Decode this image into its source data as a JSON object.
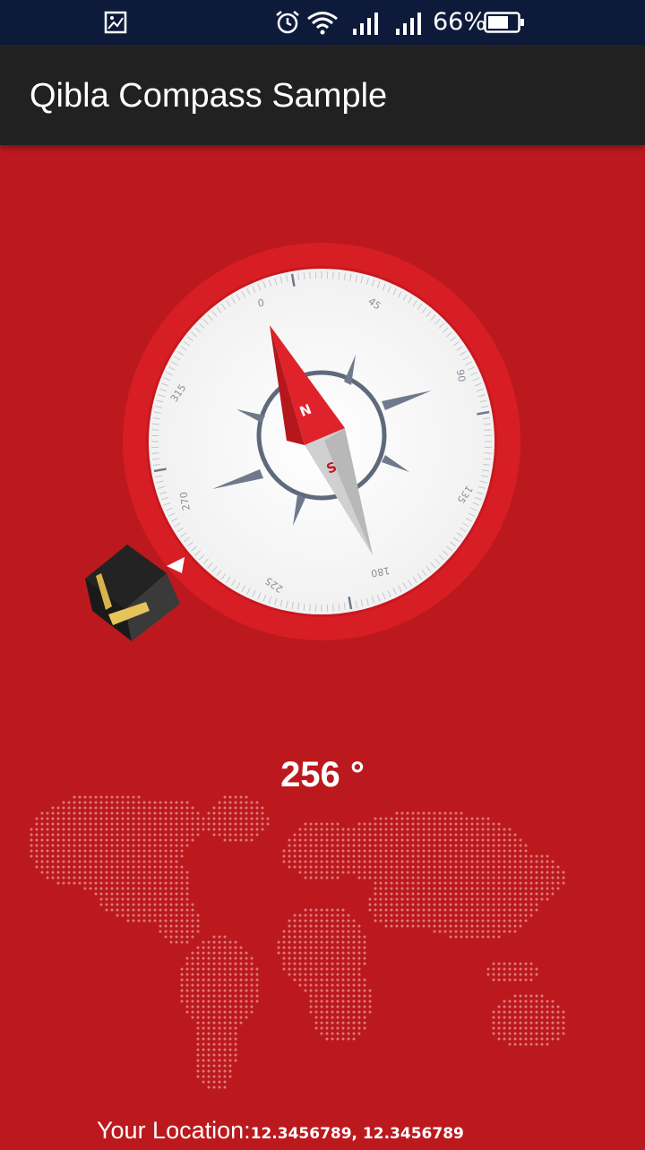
{
  "status_bar": {
    "battery_percent": "66%",
    "icons": [
      "gallery-icon",
      "alarm-icon",
      "wifi-icon",
      "signal-icon",
      "signal-icon",
      "battery-icon"
    ]
  },
  "app_bar": {
    "title": "Qibla Compass Sample"
  },
  "compass": {
    "tick_labels": [
      "0",
      "45",
      "90",
      "135",
      "180",
      "225",
      "270",
      "315"
    ],
    "north_letter": "N",
    "south_letter": "S",
    "qibla_icon": "kaaba-icon"
  },
  "direction": {
    "degree_text": "256 °"
  },
  "location": {
    "label": "Your Location:",
    "value": "12.3456789, 12.3456789"
  },
  "colors": {
    "background": "#BB191E",
    "app_bar": "#212121",
    "status_bar": "#0E1A3A",
    "compass_ring": "#D71E24",
    "needle_red": "#E0232B"
  }
}
